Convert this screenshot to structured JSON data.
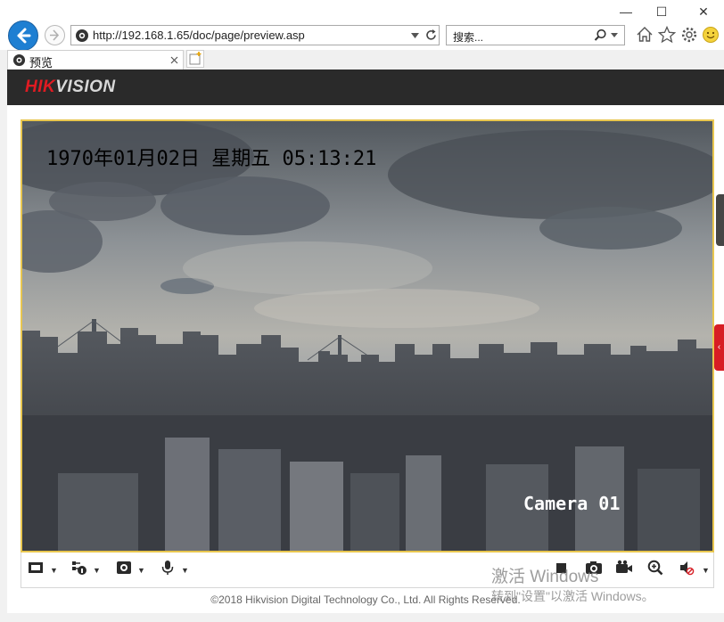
{
  "browser": {
    "address_url": "http://192.168.1.65/doc/page/preview.asp",
    "search_placeholder": "搜索...",
    "tab_title": "预览",
    "controls": {
      "minimize": "—",
      "maximize": "☐",
      "close": "✕"
    }
  },
  "header": {
    "logo_part1": "HIK",
    "logo_part2": "VISION"
  },
  "video": {
    "osd_datetime": "1970年01月02日 星期五 05:13:21",
    "osd_camera": "Camera 01"
  },
  "toolbar": {
    "items": [
      {
        "name": "window-layout-icon"
      },
      {
        "name": "stream-type-icon"
      },
      {
        "name": "plugin-icon"
      },
      {
        "name": "microphone-icon"
      },
      {
        "name": "capture-icon"
      },
      {
        "name": "snapshot-icon"
      },
      {
        "name": "record-icon"
      },
      {
        "name": "digital-zoom-icon"
      },
      {
        "name": "volume-muted-icon"
      }
    ]
  },
  "footer": {
    "copyright": "©2018 Hikvision Digital Technology Co., Ltd. All Rights Reserved."
  },
  "watermark": {
    "line1": "激活 Windows",
    "line2": "转到\"设置\"以激活 Windows。"
  }
}
